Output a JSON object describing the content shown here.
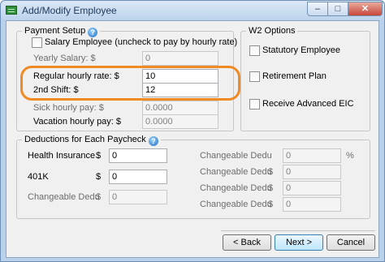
{
  "window": {
    "title": "Add/Modify Employee",
    "controls": {
      "minimize": "–",
      "maximize": "□",
      "close": "✕"
    }
  },
  "payment_setup": {
    "legend": "Payment Setup",
    "salary_employee": {
      "label": "Salary Employee (uncheck to pay by hourly rate)",
      "checked": false
    },
    "yearly_salary": {
      "label": "Yearly Salary: $",
      "value": "0"
    },
    "regular_hourly_rate": {
      "label": "Regular hourly rate: $",
      "value": "10"
    },
    "second_shift": {
      "label": "2nd Shift: $",
      "value": "12"
    },
    "sick_hourly_pay": {
      "label": "Sick hourly pay: $",
      "value": "0.0000"
    },
    "vacation_hourly_pay": {
      "label": "Vacation hourly pay: $",
      "value": "0.0000"
    }
  },
  "w2_options": {
    "legend": "W2 Options",
    "statutory_employee": {
      "label": "Statutory Employee",
      "checked": false
    },
    "retirement_plan": {
      "label": "Retirement Plan",
      "checked": false
    },
    "receive_advanced_eic": {
      "label": "Receive Advanced EIC",
      "checked": false
    }
  },
  "deductions": {
    "legend": "Deductions for Each Paycheck",
    "health_insurance": {
      "label": "Health Insurance",
      "currency": "$",
      "value": "0"
    },
    "k401": {
      "label": "401K",
      "currency": "$",
      "value": "0"
    },
    "changeable_left": {
      "label": "Changeable Dedu",
      "currency": "$",
      "value": "0"
    },
    "changeable_right": [
      {
        "label": "Changeable Dedu",
        "suffix": "%",
        "value": "0"
      },
      {
        "label": "Changeable Dedu",
        "suffix": "$",
        "value": "0"
      },
      {
        "label": "Changeable Dedu",
        "suffix": "$",
        "value": "0"
      },
      {
        "label": "Changeable Dedu",
        "suffix": "$",
        "value": "0"
      }
    ]
  },
  "buttons": {
    "back": "< Back",
    "next": "Next >",
    "cancel": "Cancel"
  },
  "icons": {
    "help": "help-icon",
    "app": "app-icon"
  },
  "colors": {
    "highlight": "#f08a24",
    "titlebar": "#bcd3ec"
  }
}
